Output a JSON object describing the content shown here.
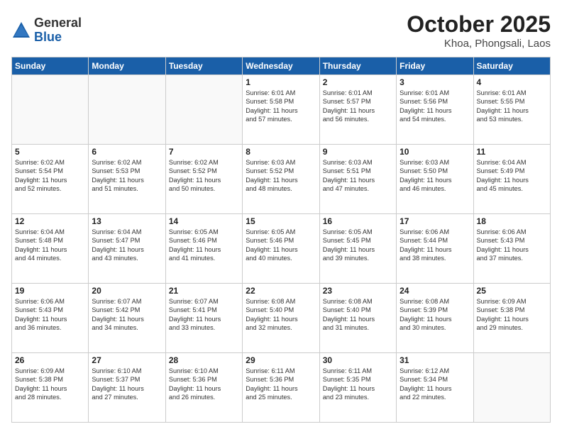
{
  "logo": {
    "general": "General",
    "blue": "Blue"
  },
  "header": {
    "month": "October 2025",
    "location": "Khoa, Phongsali, Laos"
  },
  "weekdays": [
    "Sunday",
    "Monday",
    "Tuesday",
    "Wednesday",
    "Thursday",
    "Friday",
    "Saturday"
  ],
  "weeks": [
    [
      {
        "day": "",
        "info": ""
      },
      {
        "day": "",
        "info": ""
      },
      {
        "day": "",
        "info": ""
      },
      {
        "day": "1",
        "info": "Sunrise: 6:01 AM\nSunset: 5:58 PM\nDaylight: 11 hours\nand 57 minutes."
      },
      {
        "day": "2",
        "info": "Sunrise: 6:01 AM\nSunset: 5:57 PM\nDaylight: 11 hours\nand 56 minutes."
      },
      {
        "day": "3",
        "info": "Sunrise: 6:01 AM\nSunset: 5:56 PM\nDaylight: 11 hours\nand 54 minutes."
      },
      {
        "day": "4",
        "info": "Sunrise: 6:01 AM\nSunset: 5:55 PM\nDaylight: 11 hours\nand 53 minutes."
      }
    ],
    [
      {
        "day": "5",
        "info": "Sunrise: 6:02 AM\nSunset: 5:54 PM\nDaylight: 11 hours\nand 52 minutes."
      },
      {
        "day": "6",
        "info": "Sunrise: 6:02 AM\nSunset: 5:53 PM\nDaylight: 11 hours\nand 51 minutes."
      },
      {
        "day": "7",
        "info": "Sunrise: 6:02 AM\nSunset: 5:52 PM\nDaylight: 11 hours\nand 50 minutes."
      },
      {
        "day": "8",
        "info": "Sunrise: 6:03 AM\nSunset: 5:52 PM\nDaylight: 11 hours\nand 48 minutes."
      },
      {
        "day": "9",
        "info": "Sunrise: 6:03 AM\nSunset: 5:51 PM\nDaylight: 11 hours\nand 47 minutes."
      },
      {
        "day": "10",
        "info": "Sunrise: 6:03 AM\nSunset: 5:50 PM\nDaylight: 11 hours\nand 46 minutes."
      },
      {
        "day": "11",
        "info": "Sunrise: 6:04 AM\nSunset: 5:49 PM\nDaylight: 11 hours\nand 45 minutes."
      }
    ],
    [
      {
        "day": "12",
        "info": "Sunrise: 6:04 AM\nSunset: 5:48 PM\nDaylight: 11 hours\nand 44 minutes."
      },
      {
        "day": "13",
        "info": "Sunrise: 6:04 AM\nSunset: 5:47 PM\nDaylight: 11 hours\nand 43 minutes."
      },
      {
        "day": "14",
        "info": "Sunrise: 6:05 AM\nSunset: 5:46 PM\nDaylight: 11 hours\nand 41 minutes."
      },
      {
        "day": "15",
        "info": "Sunrise: 6:05 AM\nSunset: 5:46 PM\nDaylight: 11 hours\nand 40 minutes."
      },
      {
        "day": "16",
        "info": "Sunrise: 6:05 AM\nSunset: 5:45 PM\nDaylight: 11 hours\nand 39 minutes."
      },
      {
        "day": "17",
        "info": "Sunrise: 6:06 AM\nSunset: 5:44 PM\nDaylight: 11 hours\nand 38 minutes."
      },
      {
        "day": "18",
        "info": "Sunrise: 6:06 AM\nSunset: 5:43 PM\nDaylight: 11 hours\nand 37 minutes."
      }
    ],
    [
      {
        "day": "19",
        "info": "Sunrise: 6:06 AM\nSunset: 5:43 PM\nDaylight: 11 hours\nand 36 minutes."
      },
      {
        "day": "20",
        "info": "Sunrise: 6:07 AM\nSunset: 5:42 PM\nDaylight: 11 hours\nand 34 minutes."
      },
      {
        "day": "21",
        "info": "Sunrise: 6:07 AM\nSunset: 5:41 PM\nDaylight: 11 hours\nand 33 minutes."
      },
      {
        "day": "22",
        "info": "Sunrise: 6:08 AM\nSunset: 5:40 PM\nDaylight: 11 hours\nand 32 minutes."
      },
      {
        "day": "23",
        "info": "Sunrise: 6:08 AM\nSunset: 5:40 PM\nDaylight: 11 hours\nand 31 minutes."
      },
      {
        "day": "24",
        "info": "Sunrise: 6:08 AM\nSunset: 5:39 PM\nDaylight: 11 hours\nand 30 minutes."
      },
      {
        "day": "25",
        "info": "Sunrise: 6:09 AM\nSunset: 5:38 PM\nDaylight: 11 hours\nand 29 minutes."
      }
    ],
    [
      {
        "day": "26",
        "info": "Sunrise: 6:09 AM\nSunset: 5:38 PM\nDaylight: 11 hours\nand 28 minutes."
      },
      {
        "day": "27",
        "info": "Sunrise: 6:10 AM\nSunset: 5:37 PM\nDaylight: 11 hours\nand 27 minutes."
      },
      {
        "day": "28",
        "info": "Sunrise: 6:10 AM\nSunset: 5:36 PM\nDaylight: 11 hours\nand 26 minutes."
      },
      {
        "day": "29",
        "info": "Sunrise: 6:11 AM\nSunset: 5:36 PM\nDaylight: 11 hours\nand 25 minutes."
      },
      {
        "day": "30",
        "info": "Sunrise: 6:11 AM\nSunset: 5:35 PM\nDaylight: 11 hours\nand 23 minutes."
      },
      {
        "day": "31",
        "info": "Sunrise: 6:12 AM\nSunset: 5:34 PM\nDaylight: 11 hours\nand 22 minutes."
      },
      {
        "day": "",
        "info": ""
      }
    ]
  ]
}
